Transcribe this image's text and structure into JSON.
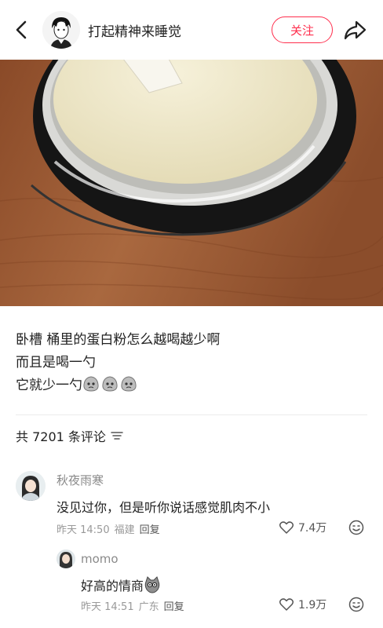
{
  "header": {
    "author_name": "打起精神来睡觉",
    "follow_label": "关注",
    "back_icon": "chevron-left-icon",
    "share_icon": "share-arrow-icon"
  },
  "post": {
    "caption_lines": [
      "卧槽 桶里的蛋白粉怎么越喝越少啊",
      "而且是喝一勺",
      "它就少一勺"
    ]
  },
  "comments_section": {
    "count_label": "共 7201 条评论"
  },
  "comments": [
    {
      "username": "秋夜雨寒",
      "text": "没见过你，但是听你说话感觉肌肉不小",
      "time": "昨天 14:50",
      "location": "福建",
      "reply_label": "回复",
      "likes": "7.4万"
    },
    {
      "username": "momo",
      "text": "好高的情商",
      "time": "昨天 14:51",
      "location": "广东",
      "reply_label": "回复",
      "likes": "1.9万"
    }
  ],
  "colors": {
    "accent": "#ff2e4d",
    "wood": "#9c5a34",
    "jar": "#1c1c1c",
    "powder": "#efe8c9"
  }
}
